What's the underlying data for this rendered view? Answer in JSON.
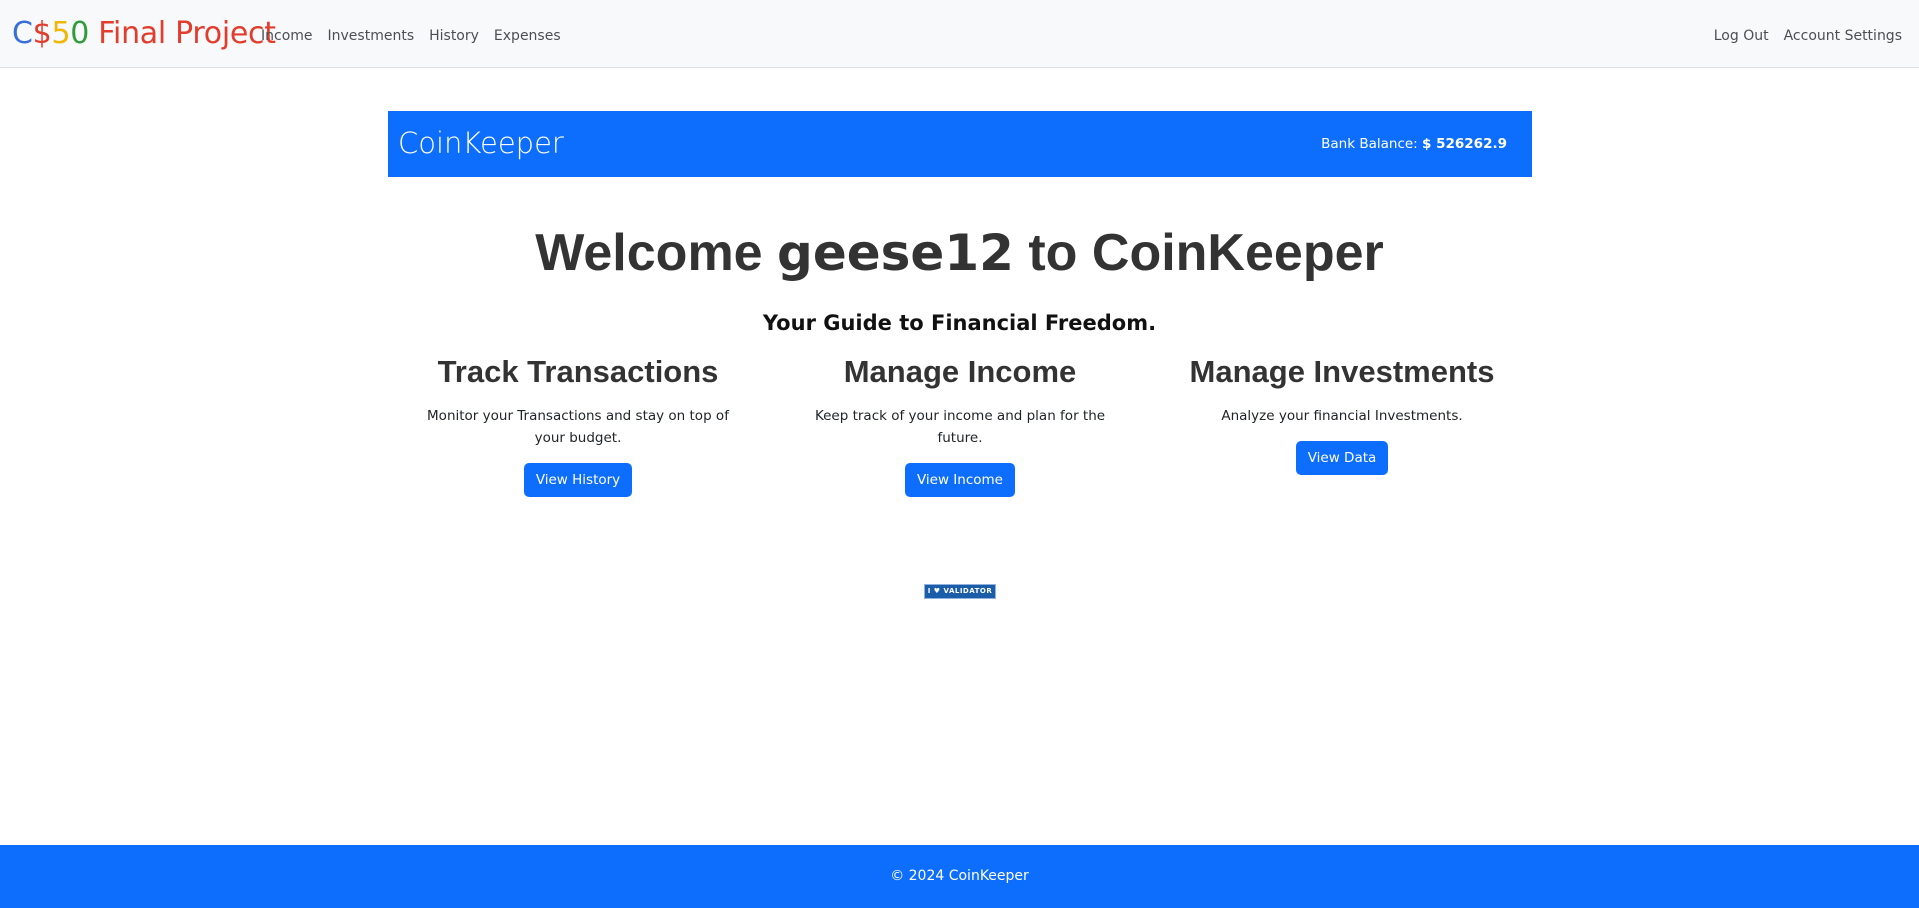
{
  "navbar": {
    "brand": {
      "parts": [
        {
          "text": "C",
          "color": "#3a6fd8"
        },
        {
          "text": "$",
          "color": "#e23c2c"
        },
        {
          "text": "5",
          "color": "#f2b705"
        },
        {
          "text": "0",
          "color": "#2f9c3a"
        },
        {
          "text": " Final Project",
          "color": "#e23c2c"
        }
      ]
    },
    "left_links": [
      "Income",
      "Investments",
      "History",
      "Expenses"
    ],
    "right_links": [
      "Log Out",
      "Account Settings"
    ]
  },
  "header": {
    "title": "CoinKeeper",
    "balance_label": "Bank Balance:",
    "balance_value": "$ 526262.9"
  },
  "welcome": {
    "prefix": "Welcome ",
    "username": "geese12",
    "suffix": " to CoinKeeper"
  },
  "tagline": "Your Guide to Financial Freedom.",
  "features": [
    {
      "title": "Track Transactions",
      "description": "Monitor your Transactions and stay on top of your budget.",
      "button": "View History"
    },
    {
      "title": "Manage Income",
      "description": "Keep track of your income and plan for the future.",
      "button": "View Income"
    },
    {
      "title": "Manage Investments",
      "description": "Analyze your financial Investments.",
      "button": "View Data"
    }
  ],
  "validator_badge": "I ♥ VALIDATOR",
  "footer": "© 2024 CoinKeeper",
  "colors": {
    "primary": "#0d6efd",
    "navbar_bg": "#f8f9fa"
  }
}
